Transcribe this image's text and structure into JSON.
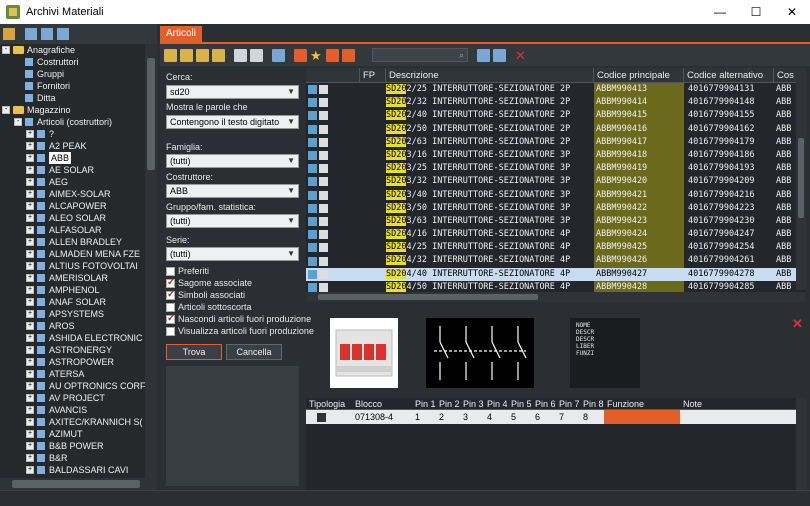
{
  "window": {
    "title": "Archivi Materiali"
  },
  "tree": {
    "items": [
      {
        "label": "Anagrafiche",
        "level": 0,
        "type": "folder",
        "exp": "-"
      },
      {
        "label": "Costruttori",
        "level": 1,
        "type": "node"
      },
      {
        "label": "Gruppi",
        "level": 1,
        "type": "node"
      },
      {
        "label": "Fornitori",
        "level": 1,
        "type": "node"
      },
      {
        "label": "Ditta",
        "level": 1,
        "type": "node"
      },
      {
        "label": "Magazzino",
        "level": 0,
        "type": "folder",
        "exp": "-"
      },
      {
        "label": "Articoli (costruttori)",
        "level": 1,
        "type": "node",
        "exp": "-"
      },
      {
        "label": "?",
        "level": 2,
        "type": "node",
        "exp": "+"
      },
      {
        "label": "A2 PEAK",
        "level": 2,
        "type": "node",
        "exp": "+"
      },
      {
        "label": "ABB",
        "level": 2,
        "type": "node",
        "exp": "+",
        "selected": true
      },
      {
        "label": "AE SOLAR",
        "level": 2,
        "type": "node",
        "exp": "+"
      },
      {
        "label": "AEG",
        "level": 2,
        "type": "node",
        "exp": "+"
      },
      {
        "label": "AIMEX-SOLAR",
        "level": 2,
        "type": "node",
        "exp": "+"
      },
      {
        "label": "ALCAPOWER",
        "level": 2,
        "type": "node",
        "exp": "+"
      },
      {
        "label": "ALEO SOLAR",
        "level": 2,
        "type": "node",
        "exp": "+"
      },
      {
        "label": "ALFASOLAR",
        "level": 2,
        "type": "node",
        "exp": "+"
      },
      {
        "label": "ALLEN BRADLEY",
        "level": 2,
        "type": "node",
        "exp": "+"
      },
      {
        "label": "ALMADEN MENA FZE",
        "level": 2,
        "type": "node",
        "exp": "+"
      },
      {
        "label": "ALTIUS FOTOVOLTAI",
        "level": 2,
        "type": "node",
        "exp": "+"
      },
      {
        "label": "AMERISOLAR",
        "level": 2,
        "type": "node",
        "exp": "+"
      },
      {
        "label": "AMPHENOL",
        "level": 2,
        "type": "node",
        "exp": "+"
      },
      {
        "label": "ANAF SOLAR",
        "level": 2,
        "type": "node",
        "exp": "+"
      },
      {
        "label": "APSYSTEMS",
        "level": 2,
        "type": "node",
        "exp": "+"
      },
      {
        "label": "AROS",
        "level": 2,
        "type": "node",
        "exp": "+"
      },
      {
        "label": "ASHIDA ELECTRONIC",
        "level": 2,
        "type": "node",
        "exp": "+"
      },
      {
        "label": "ASTRONERGY",
        "level": 2,
        "type": "node",
        "exp": "+"
      },
      {
        "label": "ASTROPOWER",
        "level": 2,
        "type": "node",
        "exp": "+"
      },
      {
        "label": "ATERSA",
        "level": 2,
        "type": "node",
        "exp": "+"
      },
      {
        "label": "AU OPTRONICS CORF",
        "level": 2,
        "type": "node",
        "exp": "+"
      },
      {
        "label": "AV PROJECT",
        "level": 2,
        "type": "node",
        "exp": "+"
      },
      {
        "label": "AVANCIS",
        "level": 2,
        "type": "node",
        "exp": "+"
      },
      {
        "label": "AXITEC/KRANNICH S(",
        "level": 2,
        "type": "node",
        "exp": "+"
      },
      {
        "label": "AZIMUT",
        "level": 2,
        "type": "node",
        "exp": "+"
      },
      {
        "label": "B&B POWER",
        "level": 2,
        "type": "node",
        "exp": "+"
      },
      {
        "label": "B&R",
        "level": 2,
        "type": "node",
        "exp": "+"
      },
      {
        "label": "BALDASSARI CAVI",
        "level": 2,
        "type": "node",
        "exp": "+"
      }
    ]
  },
  "tab": {
    "label": "Articoli"
  },
  "search": {
    "cerca_label": "Cerca:",
    "cerca_value": "sd20",
    "mostra_label": "Mostra le parole che",
    "mostra_value": "Contengono il testo digitato",
    "famiglia_label": "Famiglia:",
    "famiglia_value": "(tutti)",
    "costruttore_label": "Costruttore:",
    "costruttore_value": "ABB",
    "gruppo_label": "Gruppo/fam. statistica:",
    "gruppo_value": "(tutti)",
    "serie_label": "Serie:",
    "serie_value": "(tutti)",
    "checks": [
      {
        "label": "Preferiti",
        "checked": false
      },
      {
        "label": "Sagome associate",
        "checked": true
      },
      {
        "label": "Simboli associati",
        "checked": true
      },
      {
        "label": "Articoli sottoscorta",
        "checked": false
      },
      {
        "label": "Nascondi articoli fuori produzione",
        "checked": true
      },
      {
        "label": "Visualizza articoli fuori produzione",
        "checked": false
      }
    ],
    "trova_label": "Trova",
    "cancella_label": "Cancella"
  },
  "grid": {
    "columns": {
      "fp": "FP",
      "desc": "Descrizione",
      "cod": "Codice principale",
      "alt": "Codice alternativo",
      "co": "Cos"
    },
    "highlight": "SD20",
    "rows": [
      {
        "rest": "2/25 INTERRUTTORE-SEZIONATORE  2P",
        "cod": "ABBM990413",
        "alt": "4016779904131",
        "co": "ABB"
      },
      {
        "rest": "2/32 INTERRUTTORE-SEZIONATORE  2P",
        "cod": "ABBM990414",
        "alt": "4016779904148",
        "co": "ABB"
      },
      {
        "rest": "2/40 INTERRUTTORE-SEZIONATORE  2P",
        "cod": "ABBM990415",
        "alt": "4016779904155",
        "co": "ABB"
      },
      {
        "rest": "2/50 INTERRUTTORE-SEZIONATORE  2P",
        "cod": "ABBM990416",
        "alt": "4016779904162",
        "co": "ABB"
      },
      {
        "rest": "2/63 INTERRUTTORE-SEZIONATORE  2P",
        "cod": "ABBM990417",
        "alt": "4016779904179",
        "co": "ABB"
      },
      {
        "rest": "3/16 INTERRUTTORE-SEZIONATORE  3P",
        "cod": "ABBM990418",
        "alt": "4016779904186",
        "co": "ABB"
      },
      {
        "rest": "3/25 INTERRUTTORE-SEZIONATORE  3P",
        "cod": "ABBM990419",
        "alt": "4016779904193",
        "co": "ABB"
      },
      {
        "rest": "3/32 INTERRUTTORE-SEZIONATORE  3P",
        "cod": "ABBM990420",
        "alt": "4016779904209",
        "co": "ABB"
      },
      {
        "rest": "3/40 INTERRUTTORE-SEZIONATORE  3P",
        "cod": "ABBM990421",
        "alt": "4016779904216",
        "co": "ABB"
      },
      {
        "rest": "3/50 INTERRUTTORE-SEZIONATORE  3P",
        "cod": "ABBM990422",
        "alt": "4016779904223",
        "co": "ABB"
      },
      {
        "rest": "3/63 INTERRUTTORE-SEZIONATORE  3P",
        "cod": "ABBM990423",
        "alt": "4016779904230",
        "co": "ABB"
      },
      {
        "rest": "4/16 INTERRUTTORE-SEZIONATORE  4P",
        "cod": "ABBM990424",
        "alt": "4016779904247",
        "co": "ABB"
      },
      {
        "rest": "4/25 INTERRUTTORE-SEZIONATORE  4P",
        "cod": "ABBM990425",
        "alt": "4016779904254",
        "co": "ABB"
      },
      {
        "rest": "4/32 INTERRUTTORE-SEZIONATORE  4P",
        "cod": "ABBM990426",
        "alt": "4016779904261",
        "co": "ABB"
      },
      {
        "rest": "4/40 INTERRUTTORE-SEZIONATORE  4P",
        "cod": "ABBM990427",
        "alt": "4016779904278",
        "co": "ABB",
        "selected": true
      },
      {
        "rest": "4/50 INTERRUTTORE-SEZIONATORE  4P",
        "cod": "ABBM990428",
        "alt": "4016779904285",
        "co": "ABB"
      }
    ]
  },
  "preview": {
    "symbol_text": [
      "NOME",
      "DESCR",
      "DESCR",
      "LIBER",
      "FUNZI"
    ]
  },
  "bottom": {
    "columns": [
      "Tipologia",
      "Blocco",
      "Pin 1",
      "Pin 2",
      "Pin 3",
      "Pin 4",
      "Pin 5",
      "Pin 6",
      "Pin 7",
      "Pin 8",
      "Funzione",
      "Note"
    ],
    "row": {
      "blocco": "071308-4",
      "pins": [
        "1",
        "2",
        "3",
        "4",
        "5",
        "6",
        "7",
        "8"
      ]
    }
  },
  "colors": {
    "accent": "#e25f2a",
    "highlight": "#e8e024",
    "code_bg": "#6b6a1c"
  }
}
